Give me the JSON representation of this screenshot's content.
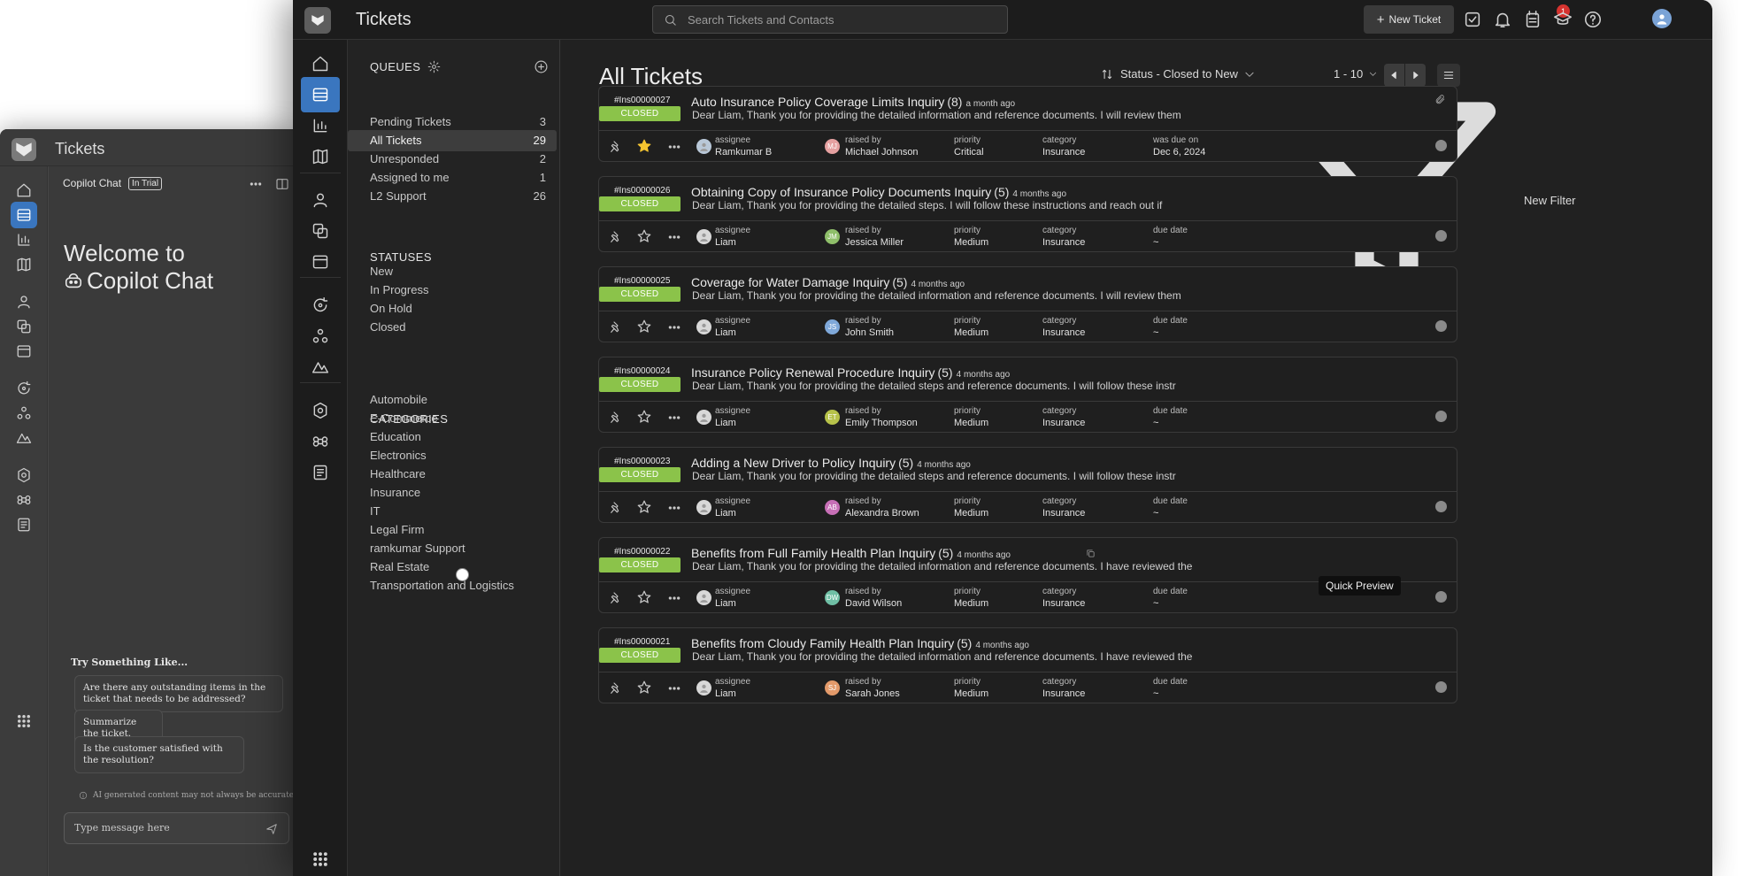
{
  "copilot_window": {
    "title": "Tickets",
    "panel_title": "Copilot Chat",
    "trial_badge": "In Trial",
    "welcome_line1": "Welcome to",
    "welcome_line2": "Copilot Chat",
    "try_heading": "Try Something Like...",
    "suggestions": [
      "Are there any outstanding items in the ticket that needs to be addressed?",
      "Summarize the ticket.",
      "Is the customer satisfied with the resolution?"
    ],
    "disclaimer": "AI generated content may not always be accurate.",
    "input_placeholder": "Type message here"
  },
  "topbar": {
    "title": "Tickets",
    "search_placeholder": "Search Tickets and Contacts",
    "new_ticket_label": "New Ticket",
    "notification_count": "1"
  },
  "sidebar": {
    "queues_heading": "QUEUES",
    "queues": [
      {
        "label": "Pending Tickets",
        "count": "3"
      },
      {
        "label": "All Tickets",
        "count": "29"
      },
      {
        "label": "Unresponded",
        "count": "2"
      },
      {
        "label": "Assigned to me",
        "count": "1"
      },
      {
        "label": "L2 Support",
        "count": "26"
      }
    ],
    "statuses_heading": "STATUSES",
    "statuses": [
      "New",
      "In Progress",
      "On Hold",
      "Closed"
    ],
    "categories_heading": "CATEGORIES",
    "categories": [
      "Automobile",
      "E-Commerce",
      "Education",
      "Electronics",
      "Healthcare",
      "Insurance",
      "IT",
      "Legal Firm",
      "ramkumar Support",
      "Real Estate",
      "Transportation and Logistics"
    ]
  },
  "main": {
    "title": "All Tickets",
    "sort_label": "Status - Closed to New",
    "filter_label": "New Filter",
    "page_range": "1 - 10",
    "tooltip": "Quick Preview"
  },
  "labels": {
    "assignee": "assignee",
    "raised_by": "raised by",
    "priority": "priority",
    "category": "category"
  },
  "tickets": [
    {
      "id": "#Ins00000027",
      "status": "CLOSED",
      "subject": "Auto Insurance Policy Coverage Limits Inquiry",
      "count": "(8)",
      "age": "a month ago",
      "preview": "Dear Liam, Thank you for providing the detailed information and reference documents. I will review them",
      "assignee": "Ramkumar B",
      "raised_by": "Michael Johnson",
      "raised_initials": "MJ",
      "raised_color": "#e6a1a1",
      "priority": "Critical",
      "category": "Insurance",
      "due_label": "was due on",
      "due_value": "Dec 6, 2024",
      "starred": true
    },
    {
      "id": "#Ins00000026",
      "status": "CLOSED",
      "subject": "Obtaining Copy of Insurance Policy Documents Inquiry",
      "count": "(5)",
      "age": "4 months ago",
      "preview": "Dear Liam, Thank you for providing the detailed steps. I will follow these instructions and reach out if",
      "assignee": "Liam",
      "raised_by": "Jessica Miller",
      "raised_initials": "JM",
      "raised_color": "#8fbf6a",
      "priority": "Medium",
      "category": "Insurance",
      "due_label": "due date",
      "due_value": "~",
      "starred": false
    },
    {
      "id": "#Ins00000025",
      "status": "CLOSED",
      "subject": "Coverage for Water Damage Inquiry",
      "count": "(5)",
      "age": "4 months ago",
      "preview": "Dear Liam, Thank you for providing the detailed information and reference documents. I will review them",
      "assignee": "Liam",
      "raised_by": "John Smith",
      "raised_initials": "JS",
      "raised_color": "#7fa8d9",
      "priority": "Medium",
      "category": "Insurance",
      "due_label": "due date",
      "due_value": "~",
      "starred": false
    },
    {
      "id": "#Ins00000024",
      "status": "CLOSED",
      "subject": "Insurance Policy Renewal Procedure Inquiry",
      "count": "(5)",
      "age": "4 months ago",
      "preview": "Dear Liam, Thank you for providing the detailed steps and reference documents. I will follow these instr",
      "assignee": "Liam",
      "raised_by": "Emily Thompson",
      "raised_initials": "ET",
      "raised_color": "#b7c24a",
      "priority": "Medium",
      "category": "Insurance",
      "due_label": "due date",
      "due_value": "~",
      "starred": false
    },
    {
      "id": "#Ins00000023",
      "status": "CLOSED",
      "subject": "Adding a New Driver to Policy Inquiry",
      "count": "(5)",
      "age": "4 months ago",
      "preview": "Dear Liam, Thank you for providing the detailed steps and reference documents. I will follow these instr",
      "assignee": "Liam",
      "raised_by": "Alexandra Brown",
      "raised_initials": "AB",
      "raised_color": "#c76fb6",
      "priority": "Medium",
      "category": "Insurance",
      "due_label": "due date",
      "due_value": "~",
      "starred": false
    },
    {
      "id": "#Ins00000022",
      "status": "CLOSED",
      "subject": "Benefits from Full Family Health Plan Inquiry",
      "count": "(5)",
      "age": "4 months ago",
      "preview": "Dear Liam, Thank you for providing the detailed information and reference documents. I have reviewed the",
      "assignee": "Liam",
      "raised_by": "David Wilson",
      "raised_initials": "DW",
      "raised_color": "#6fbfa5",
      "priority": "Medium",
      "category": "Insurance",
      "due_label": "due date",
      "due_value": "~",
      "starred": false
    },
    {
      "id": "#Ins00000021",
      "status": "CLOSED",
      "subject": "Benefits from Cloudy Family Health Plan Inquiry",
      "count": "(5)",
      "age": "4 months ago",
      "preview": "Dear Liam, Thank you for providing the detailed information and reference documents. I have reviewed the",
      "assignee": "Liam",
      "raised_by": "Sarah Jones",
      "raised_initials": "SJ",
      "raised_color": "#e39a6a",
      "priority": "Medium",
      "category": "Insurance",
      "due_label": "due date",
      "due_value": "~",
      "starred": false
    }
  ],
  "colors": {
    "accent": "#3a76bf",
    "closed_badge": "#8bc34a",
    "star": "#f4c430",
    "badge_red": "#d6332f"
  }
}
